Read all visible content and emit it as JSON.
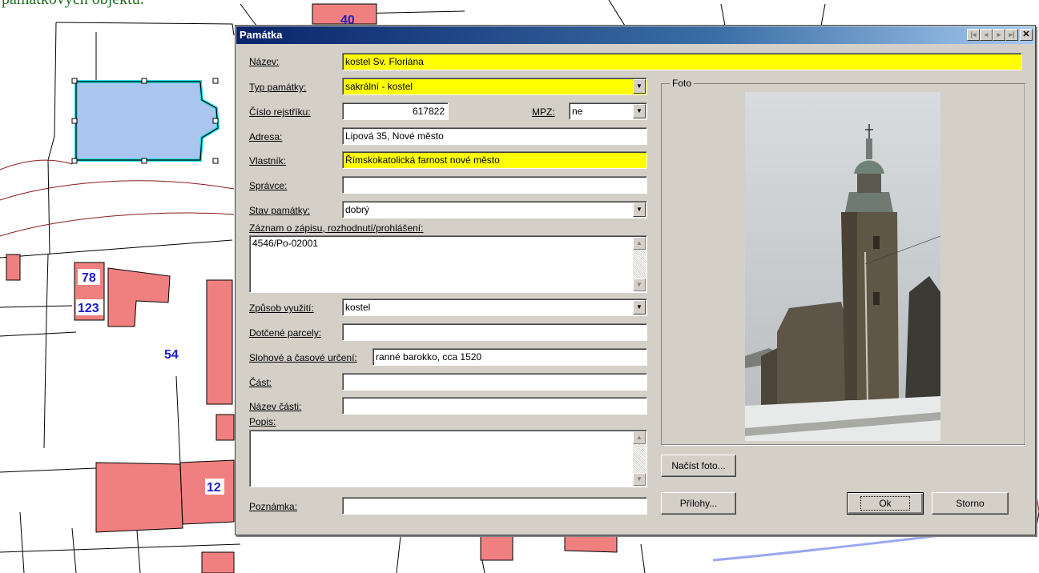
{
  "caption": "památkových objektů.",
  "map": {
    "labels": [
      "40",
      "78",
      "123",
      "54",
      "12"
    ]
  },
  "dialog": {
    "title": "Památka",
    "labels": {
      "nazev": "Název:",
      "typ": "Typ památky:",
      "cislo": "Číslo rejstříku:",
      "mpz": "MPZ:",
      "adresa": "Adresa:",
      "vlastnik": "Vlastník:",
      "spravce": "Správce:",
      "stav": "Stav památky:",
      "zaznam": "Záznam o zápisu, rozhodnutí/prohlášení:",
      "zpusob": "Způsob využití:",
      "parcely": "Dotčené parcely:",
      "slohove": "Slohové a časové určení:",
      "cast": "Část:",
      "nazev_casti": "Název části:",
      "popis": "Popis:",
      "poznamka": "Poznámka:"
    },
    "values": {
      "nazev": "kostel Sv. Floriána",
      "typ": "sakrální - kostel",
      "cislo": "617822",
      "mpz": "ne",
      "adresa": "Lipová 35, Nové město",
      "vlastnik": "Římskokatolická farnost nové město",
      "spravce": "",
      "stav": "dobrý",
      "zaznam": "4546/Po-02001",
      "zpusob": "kostel",
      "parcely": "",
      "slohove": "ranné barokko, cca 1520",
      "cast": "",
      "nazev_casti": "",
      "popis": "",
      "poznamka": ""
    },
    "foto_label": "Foto",
    "buttons": {
      "nacist": "Načíst foto...",
      "prilohy": "Přílohy...",
      "ok": "Ok",
      "storno": "Storno"
    }
  }
}
